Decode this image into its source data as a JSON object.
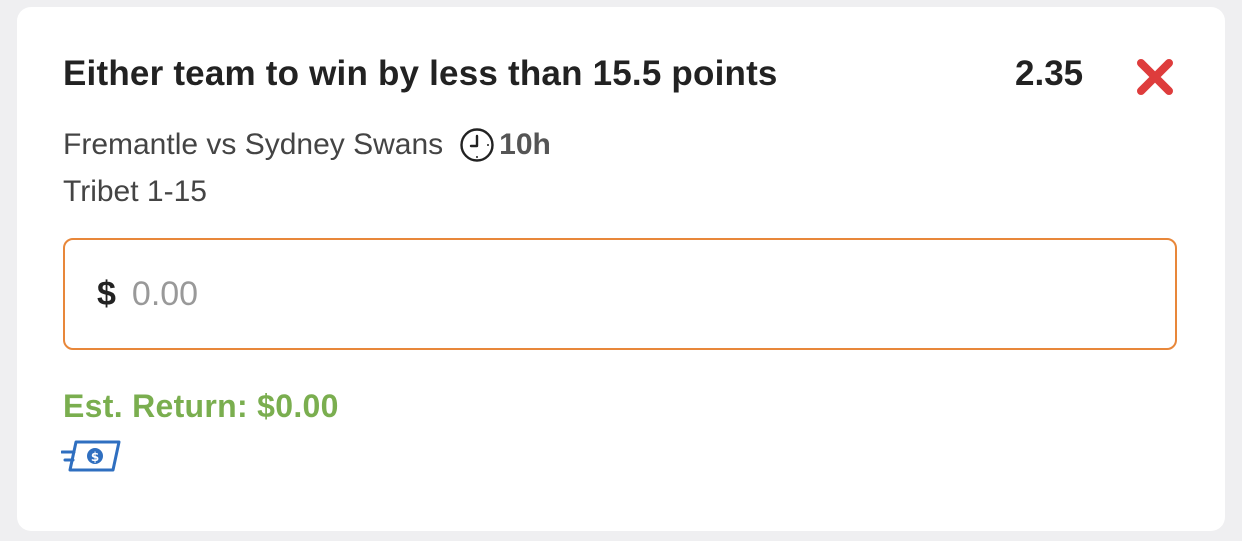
{
  "bet": {
    "title": "Either team to win by less than 15.5 points",
    "odds": "2.35",
    "match": "Fremantle vs Sydney Swans",
    "countdown": "10h",
    "market": "Tribet 1-15"
  },
  "stake": {
    "currency_symbol": "$",
    "placeholder": "0.00",
    "value": ""
  },
  "est_return": {
    "text": "Est. Return: $0.00"
  },
  "icons": {
    "close": "close-x-icon",
    "clock": "clock-icon",
    "fast_payout": "fast-cash-icon"
  },
  "colors": {
    "close": "#de3c3c",
    "input_border": "#e8873a",
    "est_return": "#7aae4f",
    "fast_icon": "#2f6fc0"
  }
}
